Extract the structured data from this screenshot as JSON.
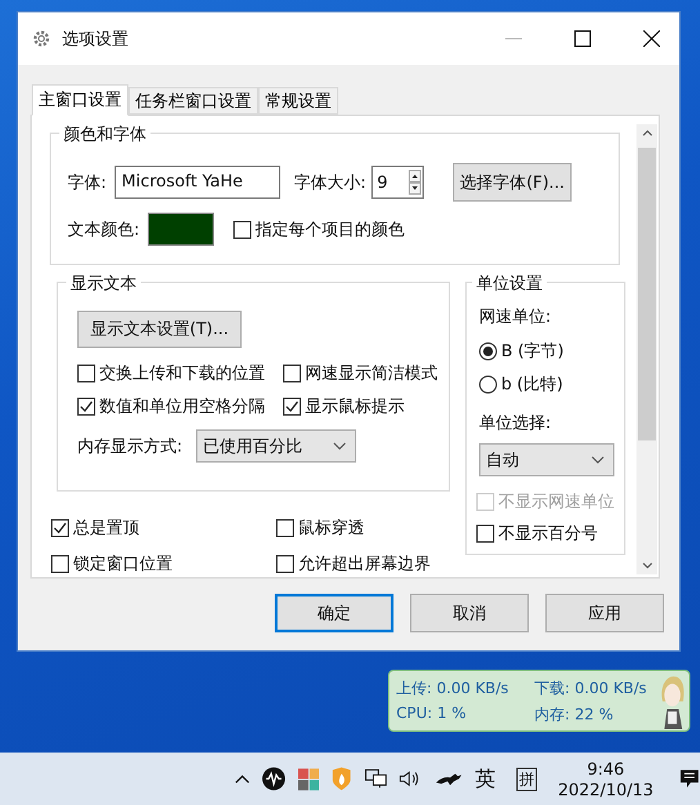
{
  "window": {
    "title": "选项设置"
  },
  "tabs": [
    {
      "label": "主窗口设置",
      "selected": true
    },
    {
      "label": "任务栏窗口设置",
      "selected": false
    },
    {
      "label": "常规设置",
      "selected": false
    }
  ],
  "color_font": {
    "title": "颜色和字体",
    "font_label": "字体:",
    "font_value": "Microsoft YaHe",
    "size_label": "字体大小:",
    "size_value": "9",
    "choose_font_button": "选择字体(F)...",
    "text_color_label": "文本颜色:",
    "per_item_color": {
      "label": "指定每个项目的颜色",
      "checked": false
    }
  },
  "display_text": {
    "title": "显示文本",
    "settings_button": "显示文本设置(T)...",
    "checkboxes": [
      {
        "label": "交换上传和下载的位置",
        "checked": false
      },
      {
        "label": "网速显示简洁模式",
        "checked": false
      },
      {
        "label": "数值和单位用空格分隔",
        "checked": true
      },
      {
        "label": "显示鼠标提示",
        "checked": true
      }
    ],
    "memory_label": "内存显示方式:",
    "memory_value": "已使用百分比"
  },
  "unit_settings": {
    "title": "单位设置",
    "speed_unit_label": "网速单位:",
    "radios": [
      {
        "label": "B (字节)",
        "selected": true
      },
      {
        "label": "b (比特)",
        "selected": false
      }
    ],
    "unit_select_label": "单位选择:",
    "unit_select_value": "自动",
    "checkboxes": [
      {
        "label": "不显示网速单位",
        "checked": false,
        "disabled": true
      },
      {
        "label": "不显示百分号",
        "checked": false,
        "disabled": false
      }
    ]
  },
  "bottom_checkboxes": [
    {
      "label": "总是置顶",
      "checked": true
    },
    {
      "label": "鼠标穿透",
      "checked": false
    },
    {
      "label": "锁定窗口位置",
      "checked": false
    },
    {
      "label": "允许超出屏幕边界",
      "checked": false
    }
  ],
  "buttons": [
    {
      "label": "确定",
      "default": true
    },
    {
      "label": "取消",
      "default": false
    },
    {
      "label": "应用",
      "default": false
    }
  ],
  "widget": {
    "items": [
      "上传: 0.00 KB/s",
      "下载: 0.00 KB/s",
      "CPU: 1 %",
      "内存: 22 %"
    ]
  },
  "taskbar": {
    "language": "英",
    "ime": "拼",
    "time": "9:46",
    "date": "2022/10/13"
  }
}
